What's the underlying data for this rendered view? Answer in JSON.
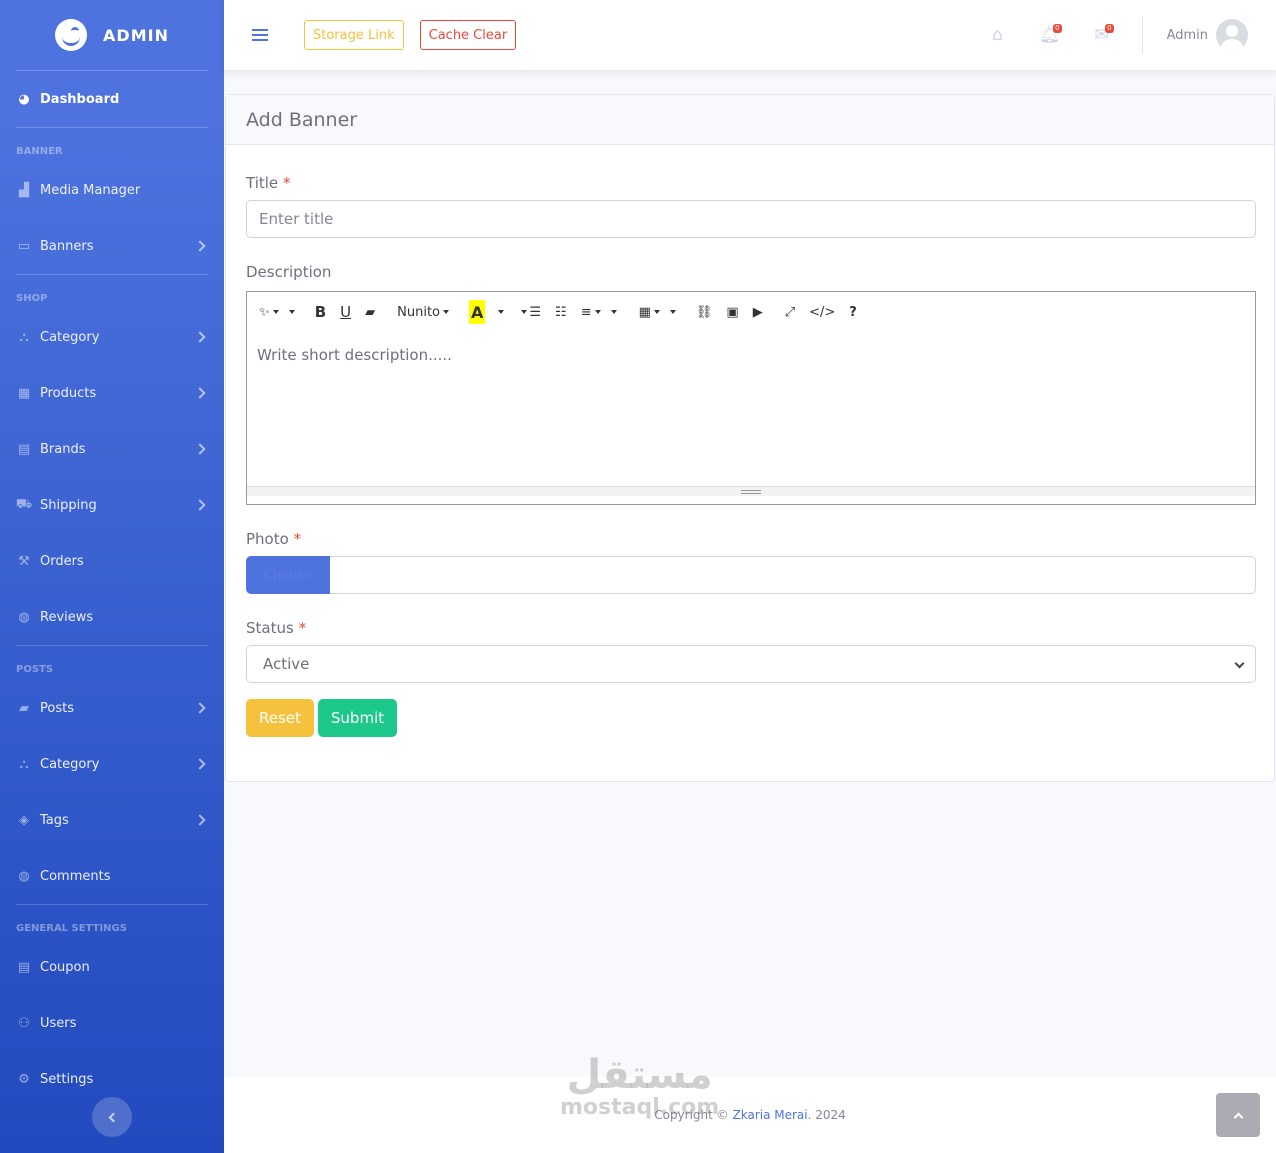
{
  "brand": {
    "name": "ADMIN"
  },
  "sidebar": {
    "dashboard": "Dashboard",
    "sections": [
      {
        "heading": "BANNER",
        "items": [
          "Media Manager",
          "Banners"
        ]
      },
      {
        "heading": "SHOP",
        "items": [
          "Category",
          "Products",
          "Brands",
          "Shipping",
          "Orders",
          "Reviews"
        ]
      },
      {
        "heading": "POSTS",
        "items": [
          "Posts",
          "Category",
          "Tags",
          "Comments"
        ]
      },
      {
        "heading": "GENERAL SETTINGS",
        "items": [
          "Coupon",
          "Users",
          "Settings"
        ]
      }
    ]
  },
  "topbar": {
    "storage_link": "Storage Link",
    "cache_clear": "Cache Clear",
    "notifications_count": "0",
    "messages_count": "0",
    "user_name": "Admin"
  },
  "form": {
    "header": "Add Banner",
    "title_label": "Title",
    "title_placeholder": "Enter title",
    "description_label": "Description",
    "description_placeholder": "Write short description.....",
    "font_name": "Nunito",
    "photo_label": "Photo",
    "choose_label": "Choose",
    "status_label": "Status",
    "status_value": "Active",
    "required_mark": "*",
    "reset_label": "Reset",
    "submit_label": "Submit"
  },
  "footer": {
    "prefix": "Copyright ©",
    "author": "Zkaria Merai",
    "year": ". 2024"
  },
  "watermark": {
    "arabic": "مستقل",
    "latin": "mostaql.com"
  },
  "colors": {
    "primary": "#4e73df",
    "warning": "#f6c23e",
    "danger": "#e74a3b",
    "success": "#1cc88a"
  }
}
